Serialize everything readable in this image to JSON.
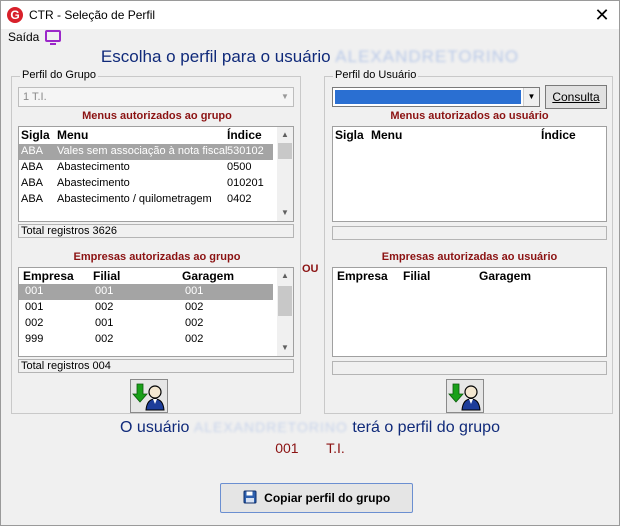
{
  "window": {
    "title": "CTR - Seleção de Perfil",
    "close_glyph": "✕",
    "app_icon_letter": "G"
  },
  "menu": {
    "saida_label": "Saída"
  },
  "headline": {
    "prefix": "Escolha o perfil para o usuário",
    "user_name": "ALEXANDRETORINO"
  },
  "group_profile": {
    "title": "Perfil do Grupo",
    "combo_value": "1 T.I.",
    "menus_title": "Menus autorizados ao grupo",
    "menus_headers": {
      "sigla": "Sigla",
      "menu": "Menu",
      "indice": "Índice"
    },
    "menus_rows": [
      {
        "sigla": "ABA",
        "menu": "Vales sem associação à nota fiscal",
        "indice": "530102",
        "selected": true
      },
      {
        "sigla": "ABA",
        "menu": "Abastecimento",
        "indice": "0500",
        "selected": false
      },
      {
        "sigla": "ABA",
        "menu": "Abastecimento",
        "indice": "010201",
        "selected": false
      },
      {
        "sigla": "ABA",
        "menu": "Abastecimento / quilometragem",
        "indice": "0402",
        "selected": false
      }
    ],
    "menus_total": "Total registros 3626",
    "empresas_title": "Empresas autorizadas ao grupo",
    "empresas_headers": {
      "empresa": "Empresa",
      "filial": "Filial",
      "garagem": "Garagem"
    },
    "empresas_rows": [
      {
        "empresa": "001",
        "filial": "001",
        "garagem": "001",
        "selected": true
      },
      {
        "empresa": "001",
        "filial": "002",
        "garagem": "002",
        "selected": false
      },
      {
        "empresa": "002",
        "filial": "001",
        "garagem": "002",
        "selected": false
      },
      {
        "empresa": "999",
        "filial": "002",
        "garagem": "002",
        "selected": false
      }
    ],
    "empresas_total": "Total registros 004"
  },
  "or_label": "OU",
  "user_profile": {
    "title": "Perfil do Usuário",
    "consulta_label": "Consulta",
    "menus_title": "Menus autorizados ao usuário",
    "menus_headers": {
      "sigla": "Sigla",
      "menu": "Menu",
      "indice": "Índice"
    },
    "empresas_title": "Empresas autorizadas ao usuário",
    "empresas_headers": {
      "empresa": "Empresa",
      "filial": "Filial",
      "garagem": "Garagem"
    }
  },
  "summary": {
    "prefix": "O usuário",
    "user_name": "ALEXANDRETORINO",
    "suffix": "terá o perfil do grupo",
    "group_code": "001",
    "group_name": "T.I."
  },
  "copy_button_label": "Copiar perfil do grupo",
  "colors": {
    "headline_blue": "#102a7a",
    "section_red": "#8b1212",
    "selection_blue": "#2a6fd2",
    "monitor_purple": "#9b27c9"
  }
}
